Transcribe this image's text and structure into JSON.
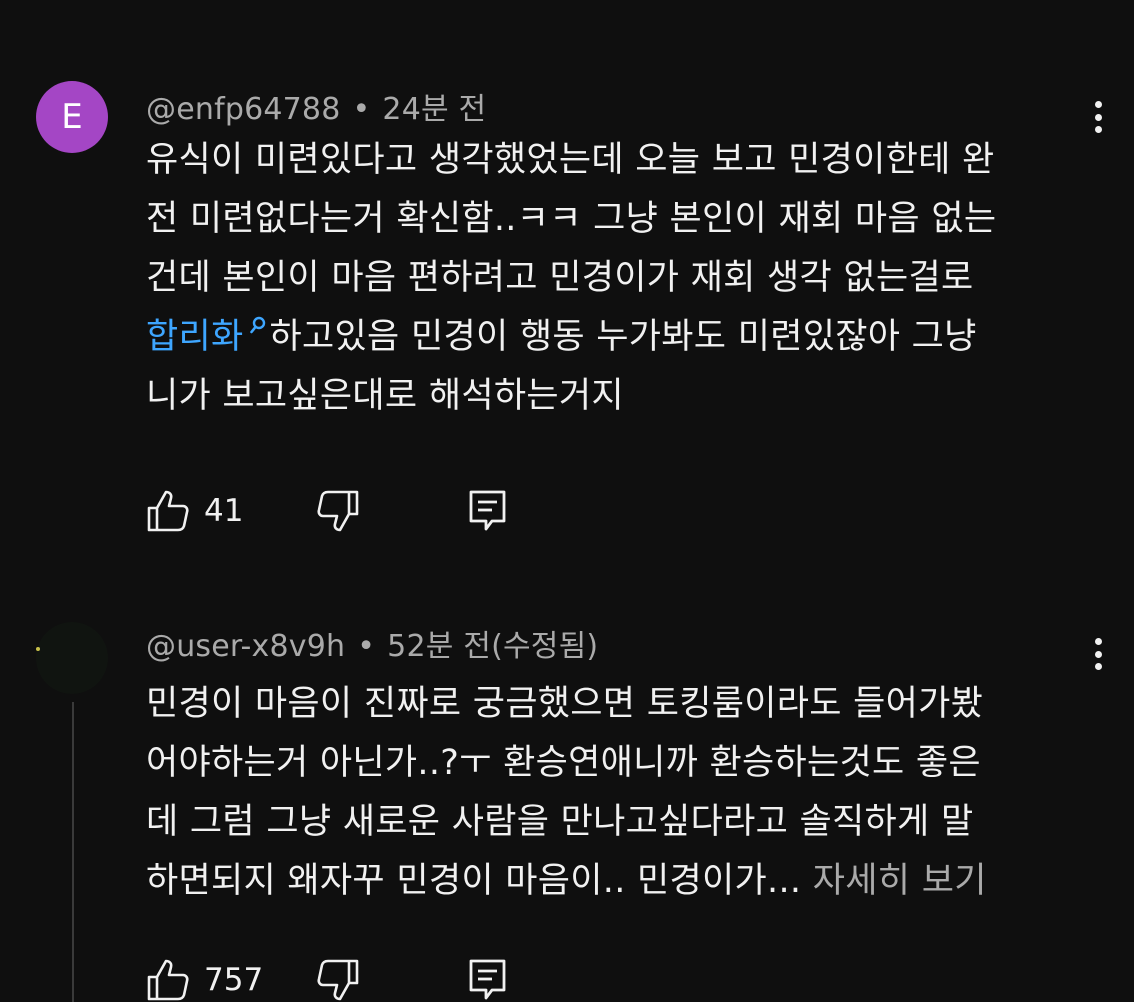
{
  "comments": [
    {
      "avatar_letter": "E",
      "username": "@enfp64788",
      "separator": "•",
      "time": "24분 전",
      "text_lines": [
        "유식이 미련있다고 생각했었는데 오늘 보고 민경이한테 완",
        "전 미련없다는거 확신함..ㅋㅋ 그냥 본인이 재회 마음 없는",
        "건데 본인이 마음 편하려고 민경이가 재회 생각 없는걸로"
      ],
      "hashtag": "합리화",
      "text_after_hashtag": "하고있음 민경이 행동 누가봐도 미련있잖아 그냥",
      "text_last_line": "니가 보고싶은대로 해석하는거지",
      "likes": "41",
      "like_icon": "thumbs-up-icon",
      "dislike_icon": "thumbs-down-icon",
      "reply_icon": "reply-icon",
      "more_icon": "more-vertical-icon"
    },
    {
      "username": "@user-x8v9h",
      "separator": "•",
      "time": "52분 전(수정됨)",
      "text_lines": [
        "민경이 마음이 진짜로 궁금했으면 토킹룸이라도 들어가봤",
        "어야하는거 아닌가..?ㅜ 환승연애니까 환승하는것도 좋은",
        "데 그럼 그냥 새로운 사람을 만나고싶다라고 솔직하게 말"
      ],
      "last_line_text": "하면되지 왜자꾸 민경이 마음이.. 민경이가...",
      "read_more": "자세히 보기",
      "likes": "757",
      "like_icon": "thumbs-up-icon",
      "dislike_icon": "thumbs-down-icon",
      "reply_icon": "reply-icon",
      "more_icon": "more-vertical-icon"
    }
  ],
  "colors": {
    "background": "#0f0f0f",
    "text": "#f1f1f1",
    "meta": "#aaaaaa",
    "hashtag": "#3ea6ff",
    "avatar_e": "#a446c5"
  }
}
